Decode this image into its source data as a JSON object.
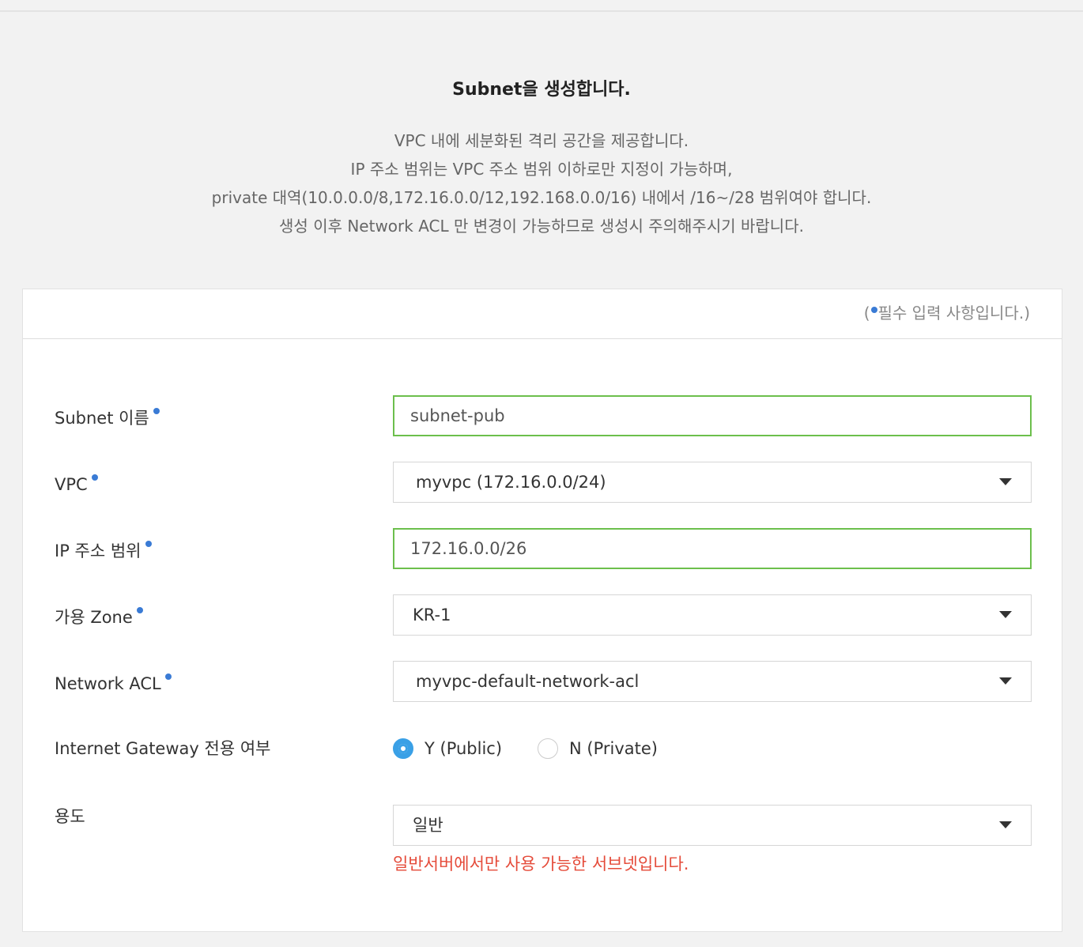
{
  "intro": {
    "title": "Subnet을 생성합니다.",
    "lines": [
      "VPC 내에 세분화된 격리 공간을 제공합니다.",
      "IP 주소 범위는 VPC 주소 범위 이하로만 지정이 가능하며,",
      "private 대역(10.0.0.0/8,172.16.0.0/12,192.168.0.0/16) 내에서 /16~/28 범위여야 합니다.",
      "생성 이후 Network ACL 만 변경이 가능하므로 생성시 주의해주시기 바랍니다."
    ]
  },
  "form": {
    "required_note_open": "(",
    "required_note_text": "필수 입력 사항입니다.)",
    "subnet_name": {
      "label": "Subnet 이름",
      "value": "subnet-pub"
    },
    "vpc": {
      "label": "VPC",
      "selected": "myvpc (172.16.0.0/24)"
    },
    "ip_range": {
      "label": "IP 주소 범위",
      "value": "172.16.0.0/26"
    },
    "zone": {
      "label": "가용 Zone",
      "selected": "KR-1"
    },
    "acl": {
      "label": "Network ACL",
      "selected": "myvpc-default-network-acl"
    },
    "igw": {
      "label": "Internet Gateway 전용 여부",
      "options": [
        {
          "label": "Y (Public)",
          "checked": true
        },
        {
          "label": "N (Private)",
          "checked": false
        }
      ]
    },
    "usage": {
      "label": "용도",
      "selected": "일반",
      "hint": "일반서버에서만 사용 가능한 서브넷입니다."
    }
  },
  "colors": {
    "required_dot": "#3a7bd5",
    "active_border": "#6cbf4c",
    "radio_checked": "#3aa0e6",
    "hint_text": "#e54b3a"
  }
}
